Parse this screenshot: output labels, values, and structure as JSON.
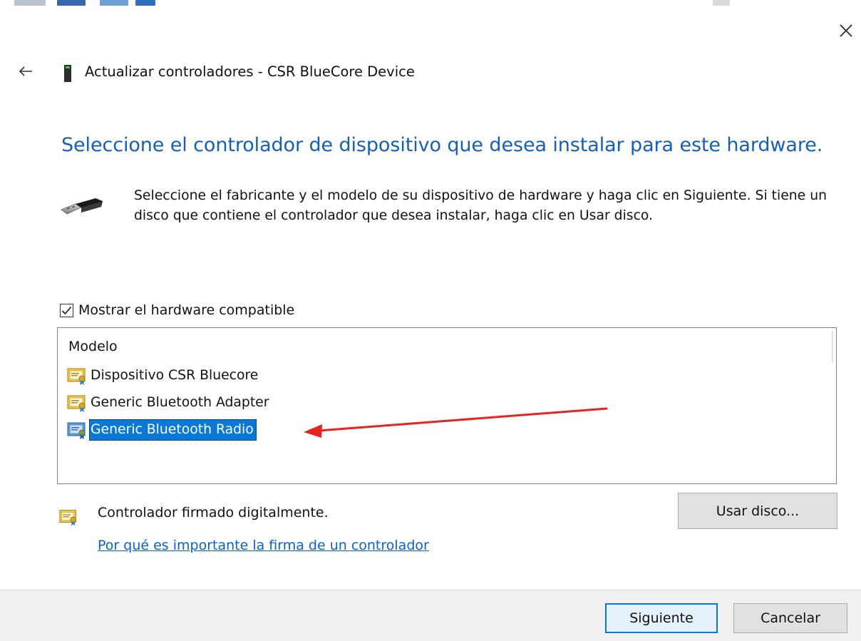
{
  "window": {
    "title": "Actualizar controladores - CSR BlueCore Device",
    "close_icon": "close-icon",
    "back_icon": "back-arrow-icon"
  },
  "main": {
    "heading": "Seleccione el controlador de dispositivo que desea instalar para este hardware.",
    "instructions": "Seleccione el fabricante y el modelo de su dispositivo de hardware y haga clic en Siguiente. Si tiene un disco que contiene el controlador que desea instalar, haga clic en Usar disco.",
    "instructions_icon": "usb-plug-icon"
  },
  "compatible": {
    "label": "Mostrar el hardware compatible",
    "checked": true
  },
  "model_list": {
    "header": "Modelo",
    "items": [
      {
        "label": "Dispositivo CSR Bluecore",
        "icon": "certified-driver-icon",
        "selected": false
      },
      {
        "label": "Generic Bluetooth Adapter",
        "icon": "certified-driver-icon",
        "selected": false
      },
      {
        "label": "Generic Bluetooth Radio",
        "icon": "certified-driver-icon",
        "selected": true
      }
    ]
  },
  "signature": {
    "status": "Controlador firmado digitalmente.",
    "link": "Por qué es importante la firma de un controlador",
    "icon": "certified-driver-icon"
  },
  "buttons": {
    "use_disk": "Usar disco...",
    "next": "Siguiente",
    "cancel": "Cancelar"
  },
  "annotation": {
    "arrow_color": "#e8231f"
  },
  "colors": {
    "heading": "#1660b4",
    "link": "#0a63c9",
    "selection": "#0a78d7",
    "footer": "#f0f0f0"
  }
}
